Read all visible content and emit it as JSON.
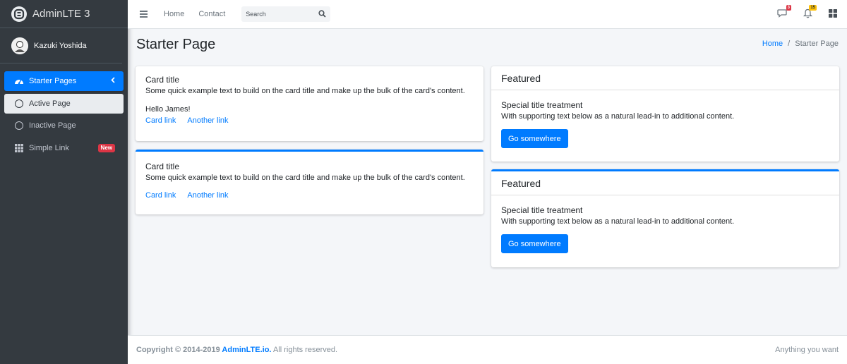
{
  "brand": {
    "name": "AdminLTE 3"
  },
  "user": {
    "name": "Kazuki Yoshida"
  },
  "sidebar": {
    "items": [
      {
        "label": "Starter Pages"
      },
      {
        "label": "Active Page"
      },
      {
        "label": "Inactive Page"
      },
      {
        "label": "Simple Link",
        "badge": "New"
      }
    ]
  },
  "topbar": {
    "links": [
      "Home",
      "Contact"
    ],
    "search_placeholder": "Search",
    "messages_count": "3",
    "notifications_count": "15"
  },
  "header": {
    "title": "Starter Page",
    "breadcrumb": [
      "Home",
      "Starter Page"
    ]
  },
  "cards": {
    "left1": {
      "title": "Card title",
      "text": "Some quick example text to build on the card title and make up the bulk of the card's content.",
      "greeting": "Hello James!",
      "link1": "Card link",
      "link2": "Another link"
    },
    "left2": {
      "title": "Card title",
      "text": "Some quick example text to build on the card title and make up the bulk of the card's content.",
      "link1": "Card link",
      "link2": "Another link"
    },
    "right1": {
      "header": "Featured",
      "title": "Special title treatment",
      "text": "With supporting text below as a natural lead-in to additional content.",
      "button": "Go somewhere"
    },
    "right2": {
      "header": "Featured",
      "title": "Special title treatment",
      "text": "With supporting text below as a natural lead-in to additional content.",
      "button": "Go somewhere"
    }
  },
  "footer": {
    "copyright_prefix": "Copyright © 2014-2019 ",
    "brand_link": "AdminLTE.io.",
    "rights": " All rights reserved.",
    "right_text": "Anything you want"
  },
  "colors": {
    "primary": "#007bff",
    "sidebar_bg": "#343a40",
    "danger": "#dc3545",
    "warning": "#ffc107"
  }
}
